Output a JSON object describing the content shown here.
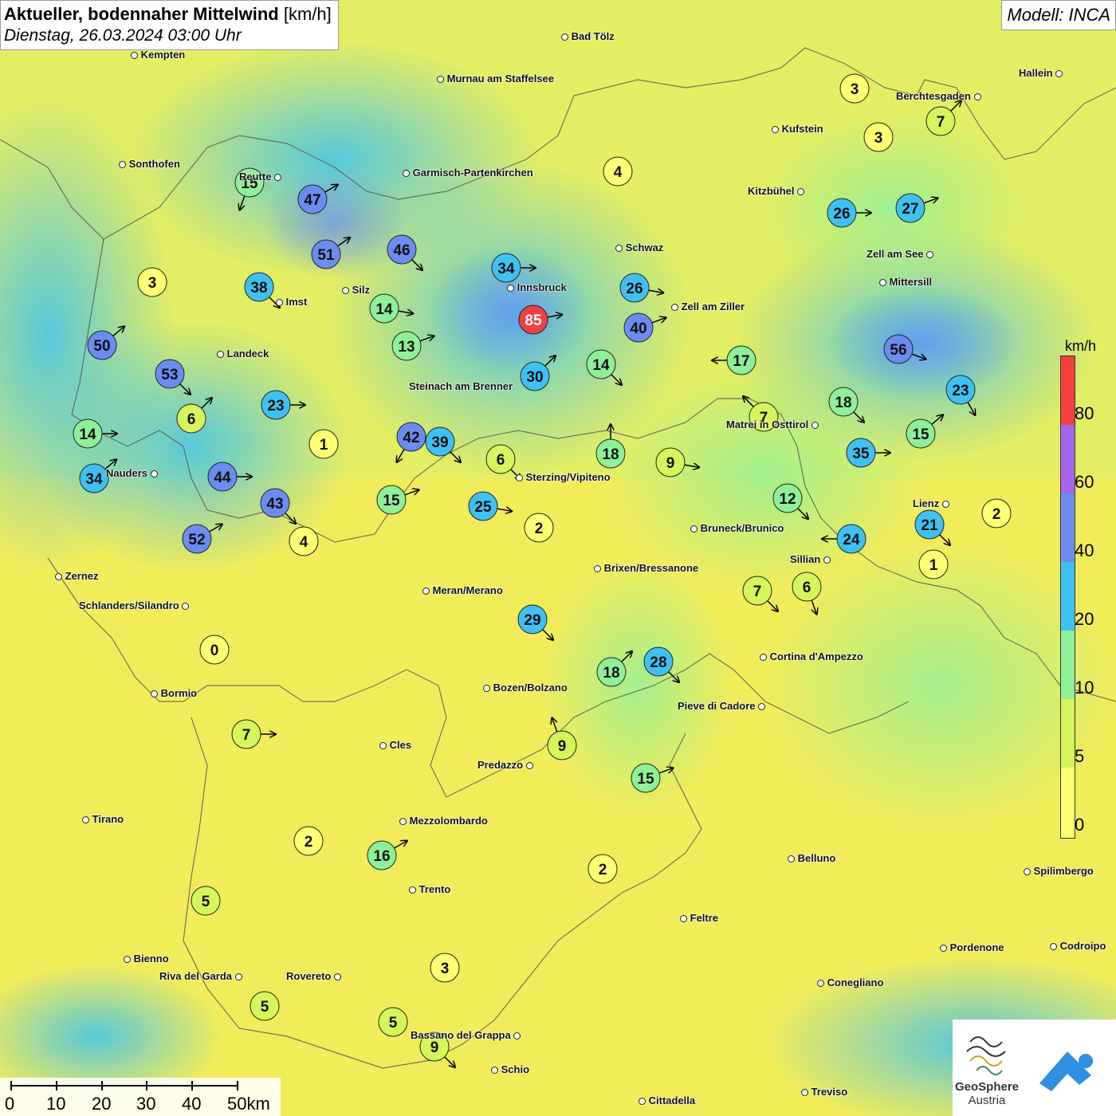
{
  "header": {
    "title_bold": "Aktueller, bodennaher Mittelwind",
    "title_unit": "[km/h]",
    "datetime": "Dienstag, 26.03.2024 03:00 Uhr",
    "model_label": "Modell: INCA"
  },
  "colors": {
    "background": "#f2ec5a",
    "scale_0_5": "#ffff73",
    "scale_5_10": "#d6f55a",
    "scale_10_20": "#8ff09a",
    "scale_20_40": "#3ec1f2",
    "scale_40_60": "#6b8cf0",
    "scale_60_80": "#a566e8",
    "scale_80_plus": "#f24040"
  },
  "legend": {
    "unit": "km/h",
    "ticks": [
      "80",
      "60",
      "40",
      "20",
      "10",
      "5",
      "0"
    ]
  },
  "scale_bar": {
    "labels": [
      "0",
      "10",
      "20",
      "30",
      "40",
      "50km"
    ]
  },
  "logos": {
    "geosphere_line1": "GeoSphere",
    "geosphere_line2": "Austria"
  },
  "cities": [
    {
      "name": "Kempten"
    },
    {
      "name": "Bad Tölz"
    },
    {
      "name": "Murnau am Staffelsee"
    },
    {
      "name": "Hallein"
    },
    {
      "name": "Berchtesgaden"
    },
    {
      "name": "Kufstein"
    },
    {
      "name": "Sonthofen"
    },
    {
      "name": "Reutte"
    },
    {
      "name": "Garmisch-Partenkirchen"
    },
    {
      "name": "Kitzbühel"
    },
    {
      "name": "Schwaz"
    },
    {
      "name": "Zell am See"
    },
    {
      "name": "Innsbruck"
    },
    {
      "name": "Mittersill"
    },
    {
      "name": "Silz"
    },
    {
      "name": "Imst"
    },
    {
      "name": "Zell am Ziller"
    },
    {
      "name": "Landeck"
    },
    {
      "name": "Steinach am Brenner"
    },
    {
      "name": "Matrei in Osttirol"
    },
    {
      "name": "Nauders"
    },
    {
      "name": "Sterzing/Vipiteno"
    },
    {
      "name": "Lienz"
    },
    {
      "name": "Bruneck/Brunico"
    },
    {
      "name": "Sillian"
    },
    {
      "name": "Zernez"
    },
    {
      "name": "Brixen/Bressanone"
    },
    {
      "name": "Meran/Merano"
    },
    {
      "name": "Schlanders/Silandro"
    },
    {
      "name": "Cortina d'Ampezzo"
    },
    {
      "name": "Bormio"
    },
    {
      "name": "Bozen/Bolzano"
    },
    {
      "name": "Pieve di Cadore"
    },
    {
      "name": "Cles"
    },
    {
      "name": "Predazzo"
    },
    {
      "name": "Tirano"
    },
    {
      "name": "Mezzolombardo"
    },
    {
      "name": "Belluno"
    },
    {
      "name": "Spilimbergo"
    },
    {
      "name": "Trento"
    },
    {
      "name": "Feltre"
    },
    {
      "name": "Bienno"
    },
    {
      "name": "Pordenone"
    },
    {
      "name": "Codroipo"
    },
    {
      "name": "Riva del Garda"
    },
    {
      "name": "Rovereto"
    },
    {
      "name": "Conegliano"
    },
    {
      "name": "Bassano del Grappa"
    },
    {
      "name": "Schio"
    },
    {
      "name": "Treviso"
    },
    {
      "name": "Cittadella"
    }
  ],
  "stations": [
    {
      "speed": 15,
      "dir_deg": 200
    },
    {
      "speed": 47,
      "dir_deg": 60
    },
    {
      "speed": 3,
      "dir_deg": 0
    },
    {
      "speed": 3,
      "dir_deg": 0
    },
    {
      "speed": 7,
      "dir_deg": 45
    },
    {
      "speed": 4,
      "dir_deg": 0
    },
    {
      "speed": 51,
      "dir_deg": 55
    },
    {
      "speed": 46,
      "dir_deg": 135
    },
    {
      "speed": 26,
      "dir_deg": 90
    },
    {
      "speed": 27,
      "dir_deg": 70
    },
    {
      "speed": 3,
      "dir_deg": 0
    },
    {
      "speed": 38,
      "dir_deg": 135
    },
    {
      "speed": 34,
      "dir_deg": 90
    },
    {
      "speed": 26,
      "dir_deg": 100
    },
    {
      "speed": 14,
      "dir_deg": 100
    },
    {
      "speed": 85,
      "dir_deg": 80
    },
    {
      "speed": 40,
      "dir_deg": 70
    },
    {
      "speed": 50,
      "dir_deg": 50
    },
    {
      "speed": 13,
      "dir_deg": 70
    },
    {
      "speed": 56,
      "dir_deg": 110
    },
    {
      "speed": 53,
      "dir_deg": 135
    },
    {
      "speed": 30,
      "dir_deg": 45
    },
    {
      "speed": 14,
      "dir_deg": 135
    },
    {
      "speed": 17,
      "dir_deg": 270
    },
    {
      "speed": 23,
      "dir_deg": 150
    },
    {
      "speed": 6,
      "dir_deg": 45
    },
    {
      "speed": 23,
      "dir_deg": 90
    },
    {
      "speed": 18,
      "dir_deg": 135
    },
    {
      "speed": 7,
      "dir_deg": 315
    },
    {
      "speed": 14,
      "dir_deg": 90
    },
    {
      "speed": 1,
      "dir_deg": 0
    },
    {
      "speed": 42,
      "dir_deg": 210
    },
    {
      "speed": 39,
      "dir_deg": 135
    },
    {
      "speed": 15,
      "dir_deg": 70
    },
    {
      "speed": 6,
      "dir_deg": 135
    },
    {
      "speed": 18,
      "dir_deg": 0
    },
    {
      "speed": 9,
      "dir_deg": 100
    },
    {
      "speed": 35,
      "dir_deg": 90
    },
    {
      "speed": 34,
      "dir_deg": 50
    },
    {
      "speed": 44,
      "dir_deg": 90
    },
    {
      "speed": 15,
      "dir_deg": 50
    },
    {
      "speed": 12,
      "dir_deg": 135
    },
    {
      "speed": 43,
      "dir_deg": 135
    },
    {
      "speed": 25,
      "dir_deg": 100
    },
    {
      "speed": 2,
      "dir_deg": 0
    },
    {
      "speed": 21,
      "dir_deg": 135
    },
    {
      "speed": 2,
      "dir_deg": 0
    },
    {
      "speed": 52,
      "dir_deg": 60
    },
    {
      "speed": 4,
      "dir_deg": 0
    },
    {
      "speed": 24,
      "dir_deg": 270
    },
    {
      "speed": 1,
      "dir_deg": 0
    },
    {
      "speed": 7,
      "dir_deg": 135
    },
    {
      "speed": 6,
      "dir_deg": 160
    },
    {
      "speed": 29,
      "dir_deg": 135
    },
    {
      "speed": 0,
      "dir_deg": 0
    },
    {
      "speed": 18,
      "dir_deg": 45
    },
    {
      "speed": 28,
      "dir_deg": 135
    },
    {
      "speed": 7,
      "dir_deg": 90
    },
    {
      "speed": 9,
      "dir_deg": 340
    },
    {
      "speed": 15,
      "dir_deg": 70
    },
    {
      "speed": 2,
      "dir_deg": 0
    },
    {
      "speed": 16,
      "dir_deg": 60
    },
    {
      "speed": 2,
      "dir_deg": 0
    },
    {
      "speed": 5,
      "dir_deg": 250
    },
    {
      "speed": 3,
      "dir_deg": 0
    },
    {
      "speed": 5,
      "dir_deg": 0
    },
    {
      "speed": 5,
      "dir_deg": 0
    },
    {
      "speed": 9,
      "dir_deg": 135
    }
  ]
}
